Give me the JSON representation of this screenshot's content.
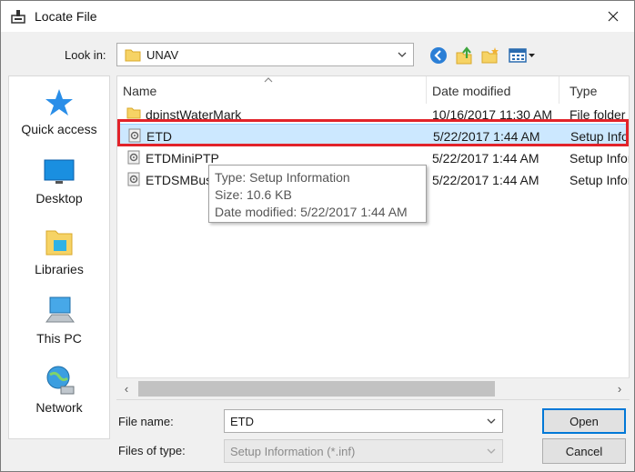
{
  "window": {
    "title": "Locate File"
  },
  "toolbar": {
    "look_in_label": "Look in:",
    "look_in_value": "UNAV"
  },
  "places": [
    {
      "label": "Quick access",
      "icon": "star-icon"
    },
    {
      "label": "Desktop",
      "icon": "desktop-icon"
    },
    {
      "label": "Libraries",
      "icon": "libraries-icon"
    },
    {
      "label": "This PC",
      "icon": "computer-icon"
    },
    {
      "label": "Network",
      "icon": "network-icon"
    }
  ],
  "columns": {
    "name": "Name",
    "date": "Date modified",
    "type": "Type"
  },
  "files": [
    {
      "name": "dpinstWaterMark",
      "date": "10/16/2017 11:30 AM",
      "type": "File folder",
      "icon": "folder-icon"
    },
    {
      "name": "ETD",
      "date": "5/22/2017 1:44 AM",
      "type": "Setup Information",
      "icon": "setup-file-icon"
    },
    {
      "name": "ETDMiniPTP",
      "date": "5/22/2017 1:44 AM",
      "type": "Setup Information",
      "icon": "setup-file-icon"
    },
    {
      "name": "ETDSMBus",
      "date": "5/22/2017 1:44 AM",
      "type": "Setup Information",
      "icon": "setup-file-icon"
    }
  ],
  "tooltip": {
    "type": "Type: Setup Information",
    "size": "Size: 10.6 KB",
    "date": "Date modified: 5/22/2017 1:44 AM"
  },
  "bottom": {
    "file_name_label": "File name:",
    "file_name_value": "ETD",
    "files_of_type_label": "Files of type:",
    "files_of_type_value": "Setup Information (*.inf)",
    "open_label": "Open",
    "cancel_label": "Cancel"
  },
  "colors": {
    "selection": "#cce8ff",
    "highlight": "#e2232a",
    "accent": "#0078d7"
  }
}
